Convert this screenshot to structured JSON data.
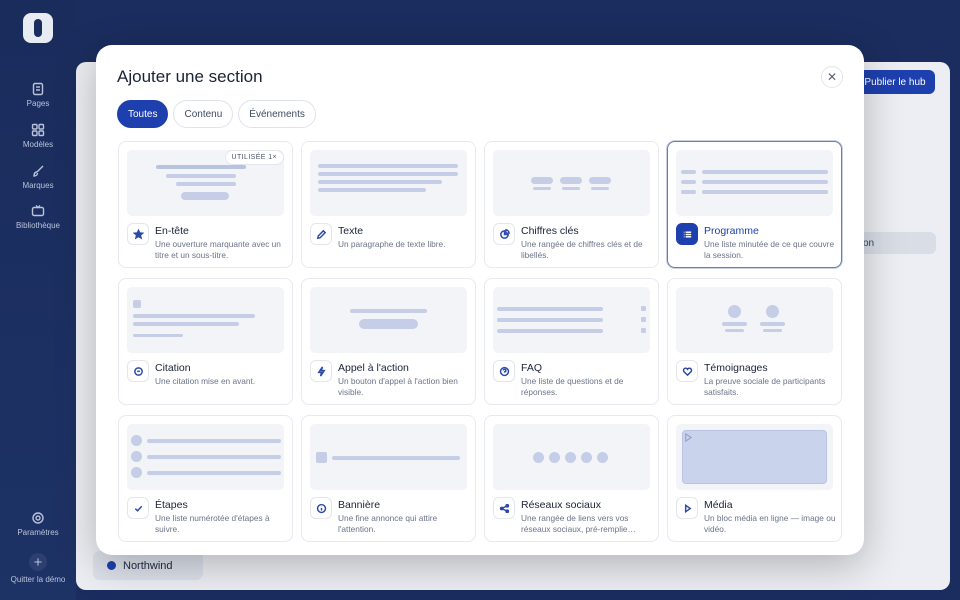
{
  "sidebar": {
    "items": [
      {
        "label": "Pages",
        "icon": "pages-icon"
      },
      {
        "label": "Modèles",
        "icon": "grid-icon"
      },
      {
        "label": "Marques",
        "icon": "brush-icon"
      },
      {
        "label": "Bibliothèque",
        "icon": "tv-icon"
      }
    ],
    "settings_label": "Paramètres",
    "quit_label": "Quitter la démo"
  },
  "background": {
    "publish_label": "Publier le hub",
    "tab_fragment": "tion",
    "workspace_label": "Northwind"
  },
  "modal": {
    "title": "Ajouter une section",
    "close_icon": "close-icon",
    "filters": [
      {
        "label": "Toutes",
        "active": true
      },
      {
        "label": "Contenu",
        "active": false
      },
      {
        "label": "Événements",
        "active": false
      }
    ],
    "sections": [
      {
        "title": "En-tête",
        "desc": "Une ouverture marquante avec un titre et un sous-titre.",
        "icon": "star-icon",
        "badge": "Utilisée 1×"
      },
      {
        "title": "Texte",
        "desc": "Un paragraphe de texte libre.",
        "icon": "edit-icon"
      },
      {
        "title": "Chiffres clés",
        "desc": "Une rangée de chiffres clés et de libellés.",
        "icon": "chart-pie-icon"
      },
      {
        "title": "Programme",
        "desc": "Une liste minutée de ce que couvre la session.",
        "icon": "list-icon",
        "selected": true
      },
      {
        "title": "Citation",
        "desc": "Une citation mise en avant.",
        "icon": "chat-icon"
      },
      {
        "title": "Appel à l'action",
        "desc": "Un bouton d'appel à l'action bien visible.",
        "icon": "bolt-icon"
      },
      {
        "title": "FAQ",
        "desc": "Une liste de questions et de réponses.",
        "icon": "question-icon"
      },
      {
        "title": "Témoignages",
        "desc": "La preuve sociale de participants satisfaits.",
        "icon": "heart-icon"
      },
      {
        "title": "Étapes",
        "desc": "Une liste numérotée d'étapes à suivre.",
        "icon": "check-icon"
      },
      {
        "title": "Bannière",
        "desc": "Une fine annonce qui attire l'attention.",
        "icon": "info-icon"
      },
      {
        "title": "Réseaux sociaux",
        "desc": "Une rangée de liens vers vos réseaux sociaux, pré-remplie…",
        "icon": "share-icon"
      },
      {
        "title": "Média",
        "desc": "Un bloc média en ligne — image ou vidéo.",
        "icon": "play-icon"
      }
    ]
  }
}
